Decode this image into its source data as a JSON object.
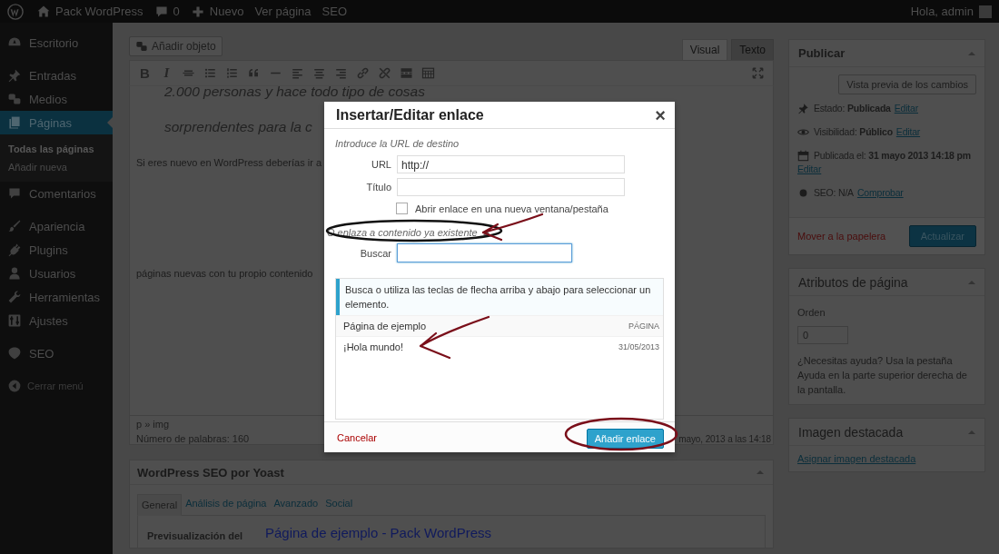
{
  "admin_bar": {
    "items": [
      {
        "kind": "logo"
      },
      {
        "kind": "home",
        "label": "Pack WordPress"
      },
      {
        "kind": "comments",
        "label": "0"
      },
      {
        "kind": "new",
        "label": "Nuevo"
      },
      {
        "kind": "text",
        "label": "Ver página"
      },
      {
        "kind": "text",
        "label": "SEO"
      }
    ],
    "greeting": "Hola, admin"
  },
  "sidebar": {
    "groups": [
      [
        {
          "kind": "dashboard",
          "label": "Escritorio",
          "selected": false
        }
      ],
      [
        {
          "kind": "pin",
          "label": "Entradas",
          "selected": false
        },
        {
          "kind": "media",
          "label": "Medios",
          "selected": false
        },
        {
          "kind": "pages",
          "label": "Páginas",
          "selected": true,
          "children": [
            {
              "label": "Todas las páginas",
              "selected": true
            },
            {
              "label": "Añadir nueva",
              "selected": false
            }
          ]
        },
        {
          "kind": "comment",
          "label": "Comentarios",
          "selected": false
        }
      ],
      [
        {
          "kind": "brush",
          "label": "Apariencia",
          "selected": false
        },
        {
          "kind": "plug",
          "label": "Plugins",
          "selected": false
        },
        {
          "kind": "user",
          "label": "Usuarios",
          "selected": false
        },
        {
          "kind": "wrench",
          "label": "Herramientas",
          "selected": false
        },
        {
          "kind": "settings",
          "label": "Ajustes",
          "selected": false
        }
      ],
      [
        {
          "kind": "seo",
          "label": "SEO",
          "selected": false
        }
      ]
    ],
    "collapse": "Cerrar menú"
  },
  "editor": {
    "add_media": "Añadir objeto",
    "tabs": [
      {
        "label": "Visual",
        "selected": true
      },
      {
        "label": "Texto",
        "selected": false
      }
    ],
    "toolbar": [
      {
        "kind": "bold",
        "label": "B"
      },
      {
        "kind": "italic",
        "label": "I"
      },
      {
        "kind": "strike"
      },
      {
        "kind": "ul"
      },
      {
        "kind": "ol"
      },
      {
        "kind": "quote"
      },
      {
        "kind": "hr"
      },
      {
        "kind": "left"
      },
      {
        "kind": "center"
      },
      {
        "kind": "right"
      },
      {
        "kind": "link"
      },
      {
        "kind": "unlink"
      },
      {
        "kind": "more"
      },
      {
        "kind": "kitchen"
      }
    ],
    "content": [
      {
        "kind": "quote",
        "text": "2.000 personas y hace todo tipo de cosas"
      },
      {
        "kind": "quote",
        "text": "sorprendentes para la c"
      },
      {
        "kind": "paragraph",
        "text": "Si eres nuevo en WordPress deberías ir a"
      },
      {
        "kind": "paragraph",
        "text": "páginas nuevas con tu propio contenido"
      }
    ],
    "path": "p » img",
    "word_count": "Número de palabras: 160",
    "last_edited": "mayo, 2013 a las 14:18"
  },
  "seo_box": {
    "title": "WordPress SEO por Yoast",
    "tabs": [
      {
        "label": "General",
        "selected": true
      },
      {
        "label": "Análisis de página",
        "selected": false
      },
      {
        "label": "Avanzado",
        "selected": false
      },
      {
        "label": "Social",
        "selected": false
      }
    ],
    "snippet_label": "Previsualización del",
    "snippet_title": "Página de ejemplo - Pack WordPress"
  },
  "publish_box": {
    "title": "Publicar",
    "preview_button": "Vista previa de los cambios",
    "rows": [
      {
        "kind": "pin",
        "text": "Estado: **Publicada**",
        "link": "Editar"
      },
      {
        "kind": "eye",
        "text": "Visibilidad: **Público**",
        "link": "Editar"
      },
      {
        "kind": "calendar",
        "text": "Publicada el: **31 mayo 2013 14:18 pm**",
        "link": "Editar"
      },
      {
        "kind": "dot",
        "text": "SEO: N/A",
        "link": "Comprobar"
      }
    ],
    "trash": "Mover a la papelera",
    "update_button": "Actualizar"
  },
  "attributes_box": {
    "title": "Atributos de página",
    "order_label": "Orden",
    "order_value": "0",
    "help": "¿Necesitas ayuda? Usa la pestaña Ayuda en la parte superior derecha de la pantalla."
  },
  "image_box": {
    "title": "Imagen destacada",
    "link": "Asignar imagen destacada"
  },
  "link_dialog": {
    "title": "Insertar/Editar enlace",
    "close": "×",
    "instruction": "Introduce la URL de destino",
    "url_label": "URL",
    "url_value": "http://",
    "title_label": "Título",
    "new_tab": {
      "label": "Abrir enlace en una nueva ventana/pestaña",
      "checked": false
    },
    "toggle": {
      "label": "O enlaza a contenido ya existente",
      "expanded": true
    },
    "search_label": "Buscar",
    "notice": "Busca o utiliza las teclas de flecha arriba y abajo para seleccionar un elemento.",
    "results": [
      {
        "title": "Página de ejemplo",
        "info": "PÁGINA"
      },
      {
        "title": "¡Hola mundo!",
        "info": "31/05/2013"
      }
    ],
    "cancel": "Cancelar",
    "submit": "Añadir enlace"
  },
  "annotations": [
    {
      "kind": "ellipse",
      "color": "#111111"
    },
    {
      "kind": "arrow",
      "color": "#7a0f1a"
    },
    {
      "kind": "arrow",
      "color": "#7a0f1a"
    },
    {
      "kind": "ellipse",
      "color": "#7a0f1a"
    }
  ]
}
